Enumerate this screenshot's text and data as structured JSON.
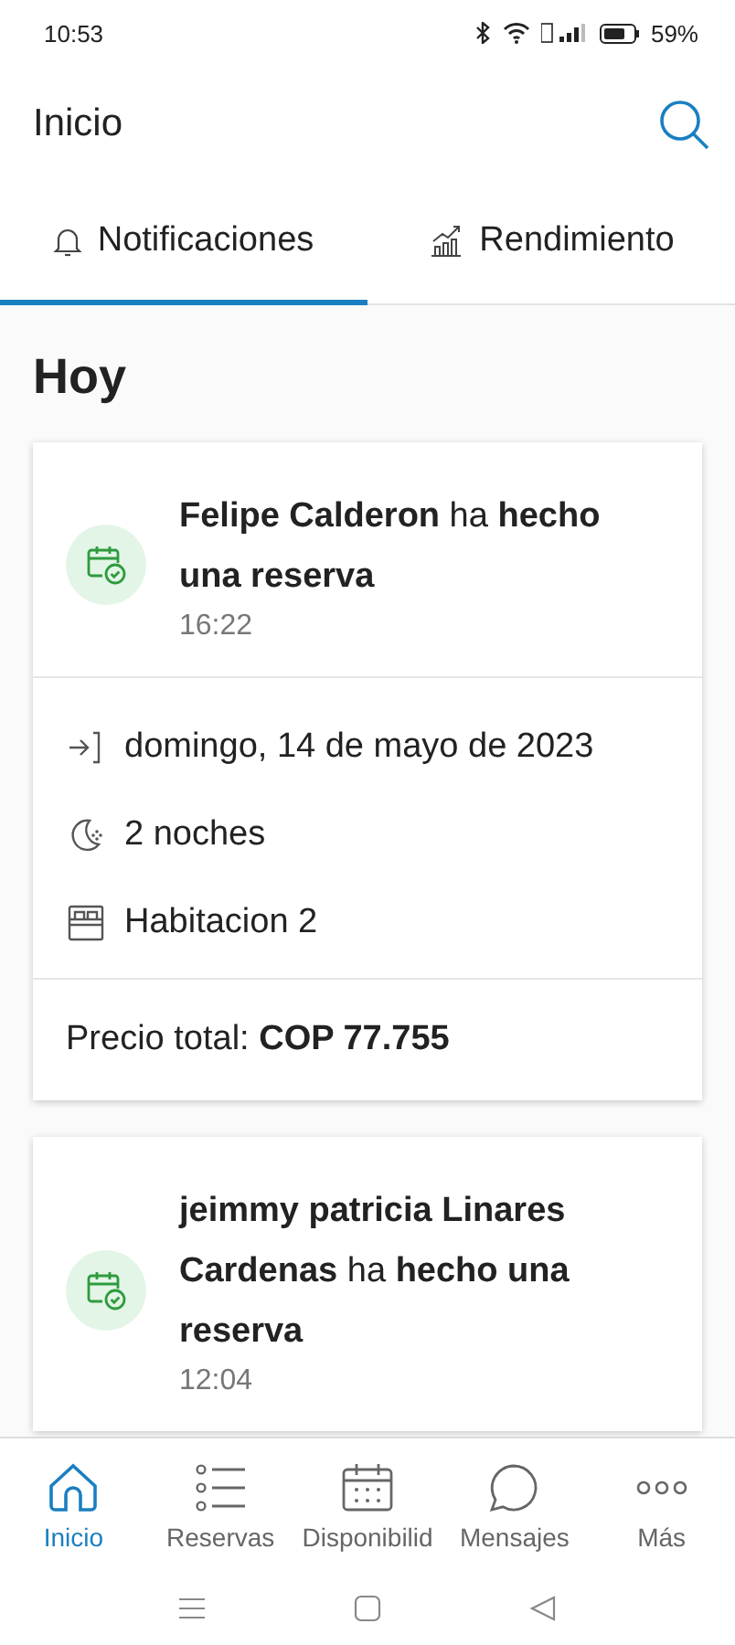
{
  "status_bar": {
    "time": "10:53",
    "battery": "59%"
  },
  "header": {
    "title": "Inicio"
  },
  "tabs": [
    {
      "label": "Notificaciones",
      "kind": "bell",
      "selected": true
    },
    {
      "label": "Rendimiento",
      "kind": "chart",
      "selected": false
    }
  ],
  "section_title": "Hoy",
  "notifications": [
    {
      "headline": "**Felipe Calderon** ha **hecho una reserva**",
      "time": "16:22",
      "details": [
        {
          "kind": "checkin",
          "text": "domingo, 14 de mayo de 2023"
        },
        {
          "kind": "nights",
          "text": "2 noches"
        },
        {
          "kind": "room",
          "text": "Habitacion 2"
        }
      ],
      "price": "Precio total: **COP 77.755**"
    },
    {
      "headline": "**jeimmy patricia Linares Cardenas** ha **hecho una reserva**",
      "time": "12:04"
    }
  ],
  "bottom_nav": [
    {
      "label": "Inicio",
      "kind": "home",
      "selected": true
    },
    {
      "label": "Reservas",
      "kind": "list",
      "selected": false
    },
    {
      "label": "Disponibilid",
      "kind": "calendar",
      "selected": false
    },
    {
      "label": "Mensajes",
      "kind": "chat",
      "selected": false
    },
    {
      "label": "Más",
      "kind": "more",
      "selected": false
    }
  ]
}
